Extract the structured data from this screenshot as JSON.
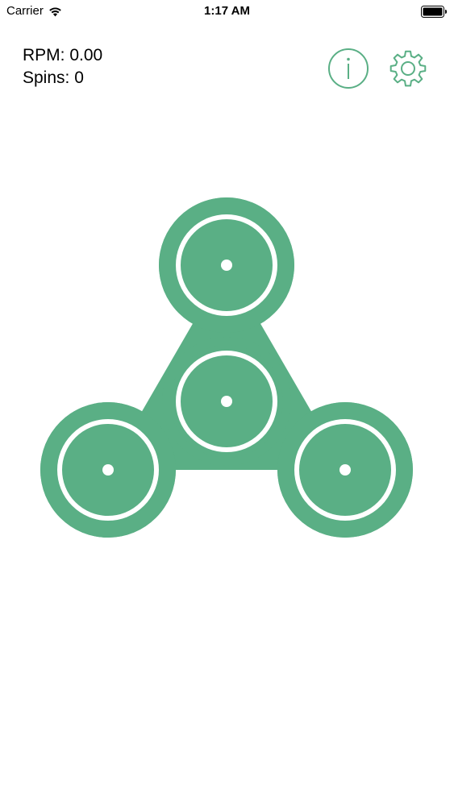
{
  "status_bar": {
    "carrier": "Carrier",
    "time": "1:17 AM",
    "icons": [
      "wifi-icon",
      "battery-icon"
    ]
  },
  "stats": {
    "rpm_text": "RPM: 0.00",
    "spins_text": "Spins: 0"
  },
  "toolbar": {
    "info_icon": "info-icon",
    "settings_icon": "gear-icon"
  },
  "spinner": {
    "color": "#5aaf85",
    "ring_color": "#ffffff",
    "background": "#ffffff"
  }
}
